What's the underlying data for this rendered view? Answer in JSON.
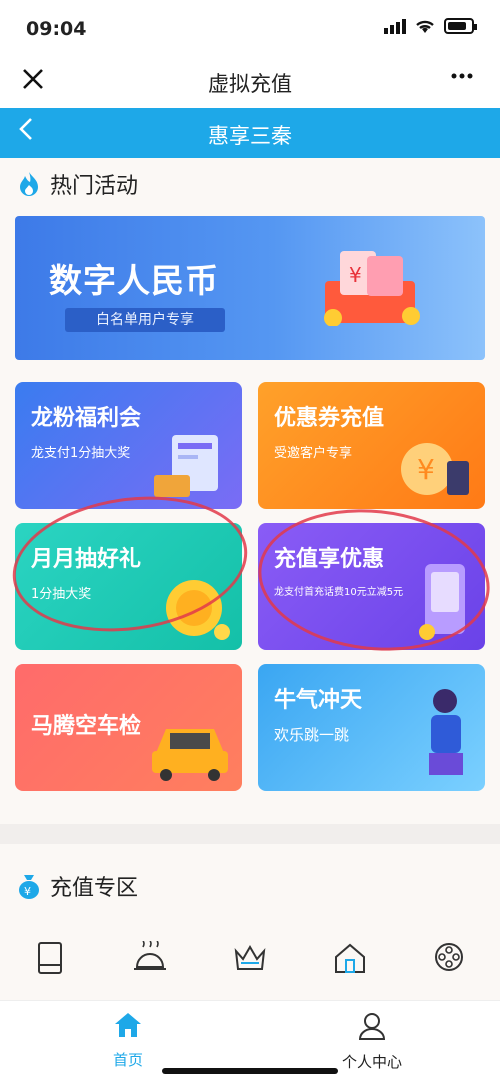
{
  "status_bar": {
    "time": "09:04"
  },
  "nav": {
    "title": "虚拟充值"
  },
  "sub_header": {
    "title": "惠享三秦"
  },
  "hot": {
    "title": "热门活动",
    "banner": {
      "title": "数字人民币",
      "subtitle": "白名单用户专享"
    },
    "cards": [
      {
        "title": "龙粉福利会",
        "subtitle": "龙支付1分抽大奖"
      },
      {
        "title": "优惠券充值",
        "subtitle": "受邀客户专享"
      },
      {
        "title": "月月抽好礼",
        "subtitle": "1分抽大奖"
      },
      {
        "title": "充值享优惠",
        "subtitle": "龙支付首充话费10元立减5元"
      },
      {
        "title": "马腾空车检",
        "subtitle": ""
      },
      {
        "title": "牛气冲天",
        "subtitle": "欢乐跳一跳"
      }
    ]
  },
  "recharge": {
    "title": "充值专区"
  },
  "tabs": [
    {
      "label": "首页"
    },
    {
      "label": "个人中心"
    }
  ],
  "colors": {
    "accent": "#1ea8e8",
    "annotation": "#e23a4a"
  }
}
